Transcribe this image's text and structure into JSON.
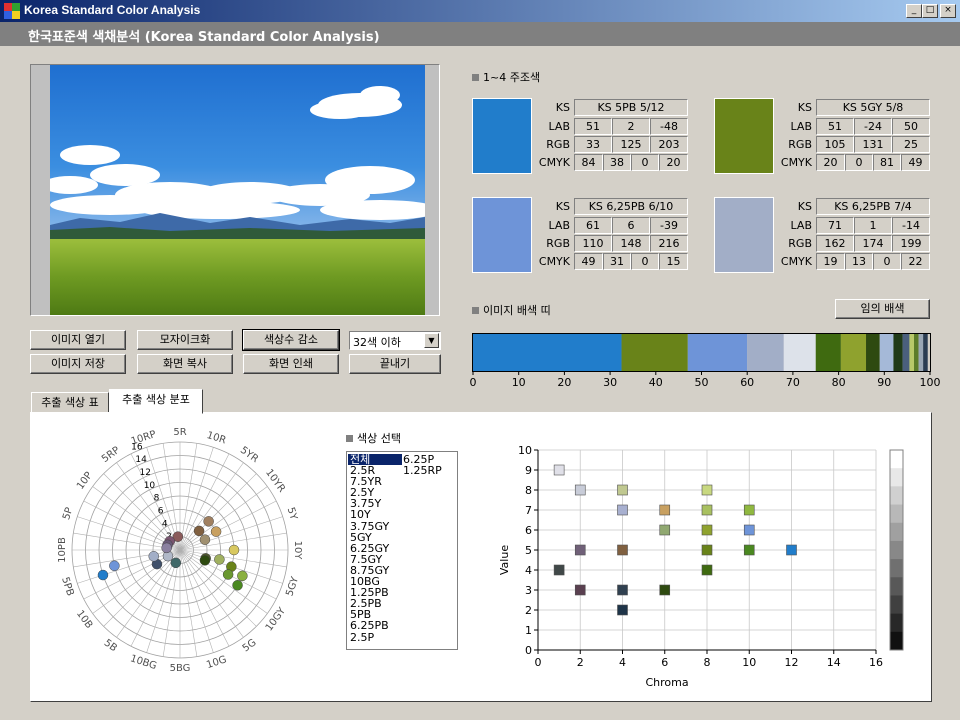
{
  "window": {
    "title": "Korea Standard Color Analysis"
  },
  "header": {
    "title": "한국표준색 색채분석 (Korea Standard Color Analysis)"
  },
  "buttons": {
    "open_image": "이미지 열기",
    "mosaic": "모자이크화",
    "reduce_colors": "색상수 감소",
    "save_image": "이미지 저장",
    "copy_screen": "화면 복사",
    "print_screen": "화면 인쇄",
    "exit": "끝내기",
    "random_palette": "임의 배색"
  },
  "color_count_select": {
    "value": "32색 이하"
  },
  "main_colors": {
    "title": "1~4 주조색",
    "row_labels": {
      "ks": "KS",
      "lab": "LAB",
      "rgb": "RGB",
      "cmyk": "CMYK"
    },
    "items": [
      {
        "color": "#217DCB",
        "ks": "KS 5PB 5/12",
        "lab": [
          "51",
          "2",
          "-48"
        ],
        "rgb": [
          "33",
          "125",
          "203"
        ],
        "cmyk": [
          "84",
          "38",
          "0",
          "20"
        ]
      },
      {
        "color": "#698319",
        "ks": "KS 5GY 5/8",
        "lab": [
          "51",
          "-24",
          "50"
        ],
        "rgb": [
          "105",
          "131",
          "25"
        ],
        "cmyk": [
          "20",
          "0",
          "81",
          "49"
        ]
      },
      {
        "color": "#6E94D8",
        "ks": "KS 6,25PB 6/10",
        "lab": [
          "61",
          "6",
          "-39"
        ],
        "rgb": [
          "110",
          "148",
          "216"
        ],
        "cmyk": [
          "49",
          "31",
          "0",
          "15"
        ]
      },
      {
        "color": "#A2AEC7",
        "ks": "KS 6,25PB 7/4",
        "lab": [
          "71",
          "1",
          "-14"
        ],
        "rgb": [
          "162",
          "174",
          "199"
        ],
        "cmyk": [
          "19",
          "13",
          "0",
          "22"
        ]
      }
    ]
  },
  "palette_strip": {
    "title": "이미지 배색 띠",
    "segments": [
      {
        "color": "#217DCB",
        "pct": 32.5
      },
      {
        "color": "#698319",
        "pct": 14.5
      },
      {
        "color": "#6E94D8",
        "pct": 13
      },
      {
        "color": "#A2AEC7",
        "pct": 8
      },
      {
        "color": "#DDE2EA",
        "pct": 7
      },
      {
        "color": "#3F6A10",
        "pct": 5.5
      },
      {
        "color": "#8FA22E",
        "pct": 5.5
      },
      {
        "color": "#2E4A10",
        "pct": 3
      },
      {
        "color": "#A5B9D8",
        "pct": 3
      },
      {
        "color": "#203A18",
        "pct": 2
      },
      {
        "color": "#4A5F7D",
        "pct": 1.5
      },
      {
        "color": "#B8C86A",
        "pct": 1
      },
      {
        "color": "#5C7B2A",
        "pct": 1
      },
      {
        "color": "#9AA7B5",
        "pct": 1
      },
      {
        "color": "#2B3D52",
        "pct": 1
      }
    ],
    "ticks": [
      "0",
      "10",
      "20",
      "30",
      "40",
      "50",
      "60",
      "70",
      "80",
      "90",
      "100"
    ]
  },
  "tabs": [
    {
      "label": "추출 색상 표",
      "active": false
    },
    {
      "label": "추출 색상 분포",
      "active": true
    }
  ],
  "hue_wheel": {
    "hue_labels": [
      "5R",
      "10R",
      "5YR",
      "10YR",
      "5Y",
      "10Y",
      "5GY",
      "10GY",
      "5G",
      "10G",
      "5BG",
      "10BG",
      "5B",
      "10B",
      "5PB",
      "10PB",
      "5P",
      "10P",
      "5RP",
      "10RP"
    ],
    "radial_ticks": [
      "2",
      "4",
      "6",
      "8",
      "10",
      "12",
      "14",
      "16"
    ],
    "points": [
      {
        "hue": "2.5R",
        "chroma": 2,
        "color": "#8A5A5A"
      },
      {
        "hue": "1.25RP",
        "chroma": 2,
        "color": "#7A5570"
      },
      {
        "hue": "6.25P",
        "chroma": 2,
        "color": "#6A5A78"
      },
      {
        "hue": "7.5YR",
        "chroma": 4,
        "color": "#806040"
      },
      {
        "hue": "7.5YR",
        "chroma": 6,
        "color": "#A08060"
      },
      {
        "hue": "2.5Y",
        "chroma": 6,
        "color": "#C8A060"
      },
      {
        "hue": "3.75Y",
        "chroma": 4,
        "color": "#A09070"
      },
      {
        "hue": "10Y",
        "chroma": 8,
        "color": "#D8C860"
      },
      {
        "hue": "3.75GY",
        "chroma": 6,
        "color": "#A0B060"
      },
      {
        "hue": "5GY",
        "chroma": 8,
        "color": "#698319"
      },
      {
        "hue": "5GY",
        "chroma": 4,
        "color": "#505830"
      },
      {
        "hue": "6.25GY",
        "chroma": 10,
        "color": "#8AB040"
      },
      {
        "hue": "6.25GY",
        "chroma": 4,
        "color": "#2E4A10"
      },
      {
        "hue": "7.5GY",
        "chroma": 8,
        "color": "#6A9830"
      },
      {
        "hue": "8.75GY",
        "chroma": 10,
        "color": "#4A8820"
      },
      {
        "hue": "10BG",
        "chroma": 2,
        "color": "#406868"
      },
      {
        "hue": "1.25PB",
        "chroma": 4,
        "color": "#40506A"
      },
      {
        "hue": "2.5PB",
        "chroma": 2,
        "color": "#B0B8C8"
      },
      {
        "hue": "5PB",
        "chroma": 12,
        "color": "#217DCB"
      },
      {
        "hue": "6.25PB",
        "chroma": 10,
        "color": "#6E94D8"
      },
      {
        "hue": "6.25PB",
        "chroma": 4,
        "color": "#A2AEC7"
      },
      {
        "hue": "2.5P",
        "chroma": 2,
        "color": "#8A80A0"
      }
    ]
  },
  "color_select": {
    "title": "색상 선택",
    "items_col1": [
      "전체",
      "2.5R",
      "7.5YR",
      "2.5Y",
      "3.75Y",
      "10Y",
      "3.75GY",
      "5GY",
      "6.25GY",
      "7.5GY",
      "8.75GY",
      "10BG",
      "1.25PB",
      "2.5PB",
      "5PB",
      "6.25PB",
      "2.5P"
    ],
    "items_col2": [
      "6.25P",
      "1.25RP"
    ],
    "selected": "전체"
  },
  "chart_data": {
    "type": "scatter",
    "xlabel": "Chroma",
    "ylabel": "Value",
    "xlim": [
      0,
      16
    ],
    "ylim": [
      0,
      10
    ],
    "xticks": [
      "0",
      "2",
      "4",
      "6",
      "8",
      "10",
      "12",
      "14",
      "16"
    ],
    "yticks": [
      "0",
      "1",
      "2",
      "3",
      "4",
      "5",
      "6",
      "7",
      "8",
      "9",
      "10"
    ],
    "grid": true,
    "points": [
      {
        "x": 1,
        "y": 9,
        "color": "#E0E0E8"
      },
      {
        "x": 1,
        "y": 4,
        "color": "#404848"
      },
      {
        "x": 2,
        "y": 8,
        "color": "#C8CCD8"
      },
      {
        "x": 2,
        "y": 5,
        "color": "#706078"
      },
      {
        "x": 2,
        "y": 3,
        "color": "#5A4050"
      },
      {
        "x": 4,
        "y": 8,
        "color": "#C0C890"
      },
      {
        "x": 4,
        "y": 7,
        "color": "#A8B0D0"
      },
      {
        "x": 4,
        "y": 5,
        "color": "#806040"
      },
      {
        "x": 4,
        "y": 3,
        "color": "#304050"
      },
      {
        "x": 4,
        "y": 2,
        "color": "#1E3448"
      },
      {
        "x": 6,
        "y": 7,
        "color": "#C8A060"
      },
      {
        "x": 6,
        "y": 6,
        "color": "#90A870"
      },
      {
        "x": 6,
        "y": 3,
        "color": "#2E4A10"
      },
      {
        "x": 8,
        "y": 8,
        "color": "#C8D880"
      },
      {
        "x": 8,
        "y": 7,
        "color": "#A8C060"
      },
      {
        "x": 8,
        "y": 6,
        "color": "#8FA22E"
      },
      {
        "x": 8,
        "y": 5,
        "color": "#698319"
      },
      {
        "x": 8,
        "y": 4,
        "color": "#3F6A10"
      },
      {
        "x": 10,
        "y": 7,
        "color": "#90B840"
      },
      {
        "x": 10,
        "y": 6,
        "color": "#6E94D8"
      },
      {
        "x": 10,
        "y": 5,
        "color": "#4A8820"
      },
      {
        "x": 12,
        "y": 5,
        "color": "#217DCB"
      }
    ],
    "value_scale": [
      "#FFFFFF",
      "#E8E8E8",
      "#D0D0D0",
      "#B8B8B8",
      "#A0A0A0",
      "#888888",
      "#707070",
      "#585858",
      "#404040",
      "#282828",
      "#101010"
    ]
  }
}
